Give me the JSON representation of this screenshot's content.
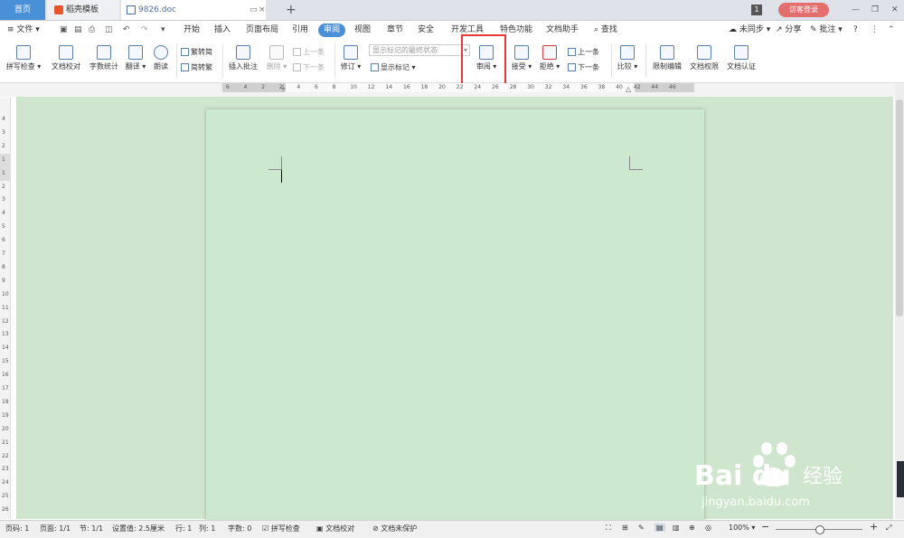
{
  "tabs": {
    "home": "首页",
    "template": "稻壳模板",
    "doc": "9826.doc",
    "counter": "1",
    "guest": "访客登录"
  },
  "quick": {
    "file": "文件"
  },
  "menu": [
    "开始",
    "插入",
    "页面布局",
    "引用",
    "审阅",
    "视图",
    "章节",
    "安全",
    "开发工具",
    "特色功能",
    "文档助手",
    "查找"
  ],
  "menu_right": {
    "sync": "未同步",
    "share": "分享",
    "comment": "批注",
    "help": "?"
  },
  "ribbon": {
    "spell": "拼写检查",
    "doccheck": "文档校对",
    "wordcount": "字数统计",
    "translate": "翻译",
    "read": "朗读",
    "trad": "繁转简",
    "simp": "简转繁",
    "insertcomment": "插入批注",
    "delete": "删除",
    "prev": "上一条",
    "next": "下一条",
    "track": "修订",
    "display_state": "显示标记的最终状态",
    "show_markup": "显示标记",
    "review": "审阅",
    "accept": "接受",
    "reject": "拒绝",
    "prev2": "上一条",
    "next2": "下一条",
    "compare": "比较",
    "restrict": "限制编辑",
    "perm": "文档权限",
    "cert": "文档认证"
  },
  "ruler_h": [
    "6",
    "4",
    "2",
    "2",
    "4",
    "6",
    "8",
    "10",
    "12",
    "14",
    "16",
    "18",
    "20",
    "22",
    "24",
    "26",
    "28",
    "30",
    "32",
    "34",
    "36",
    "38",
    "40",
    "42",
    "44",
    "46"
  ],
  "ruler_v": [
    "4",
    "3",
    "2",
    "1",
    "1",
    "2",
    "3",
    "4",
    "5",
    "6",
    "7",
    "8",
    "9",
    "10",
    "11",
    "12",
    "13",
    "14",
    "15",
    "16",
    "17",
    "18",
    "19",
    "20",
    "21",
    "22",
    "23",
    "24",
    "25",
    "26"
  ],
  "status": {
    "page": "页码: 1",
    "pages": "页面: 1/1",
    "section": "节: 1/1",
    "setting": "设置值: 2.5厘米",
    "row": "行: 1",
    "col": "列: 1",
    "words": "字数: 0",
    "spell": "拼写检查",
    "proof": "文档校对",
    "protect": "文档未保护",
    "zoom": "100%"
  },
  "watermark": {
    "brand": "Bai du 经验",
    "url": "jingyan.baidu.com"
  },
  "colors": {
    "accent": "#4a90d9",
    "highlight": "#e53935",
    "page_bg": "#cce8cf"
  }
}
